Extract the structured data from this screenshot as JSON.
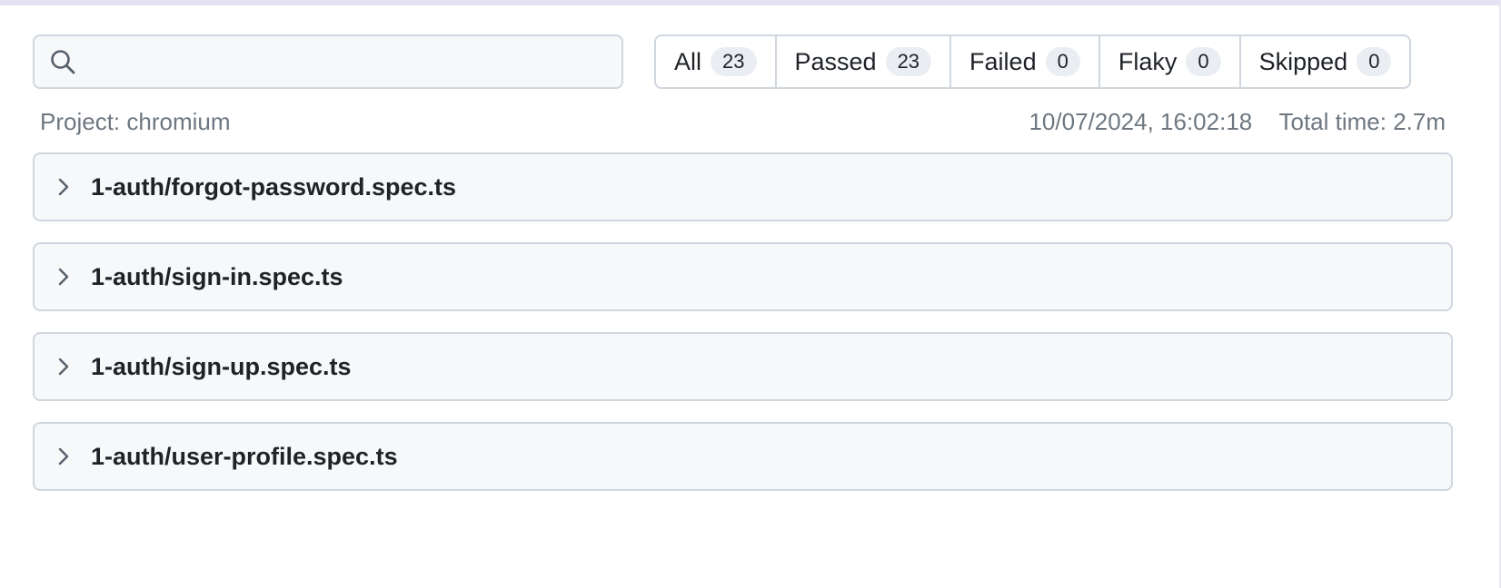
{
  "search": {
    "value": "",
    "placeholder": ""
  },
  "filters": [
    {
      "label": "All",
      "count": "23"
    },
    {
      "label": "Passed",
      "count": "23"
    },
    {
      "label": "Failed",
      "count": "0"
    },
    {
      "label": "Flaky",
      "count": "0"
    },
    {
      "label": "Skipped",
      "count": "0"
    }
  ],
  "meta": {
    "project": "Project: chromium",
    "timestamp": "10/07/2024, 16:02:18",
    "total_time": "Total time: 2.7m"
  },
  "files": [
    {
      "name": "1-auth/forgot-password.spec.ts"
    },
    {
      "name": "1-auth/sign-in.spec.ts"
    },
    {
      "name": "1-auth/sign-up.spec.ts"
    },
    {
      "name": "1-auth/user-profile.spec.ts"
    }
  ],
  "icons": {
    "search": "search-icon",
    "expand": "chevron-right-icon"
  },
  "colors": {
    "border": "#d0d7de",
    "surface": "#f6f8fa",
    "muted_text": "#6e7781",
    "text": "#1f2328",
    "counter_bg": "#eaeef2"
  }
}
